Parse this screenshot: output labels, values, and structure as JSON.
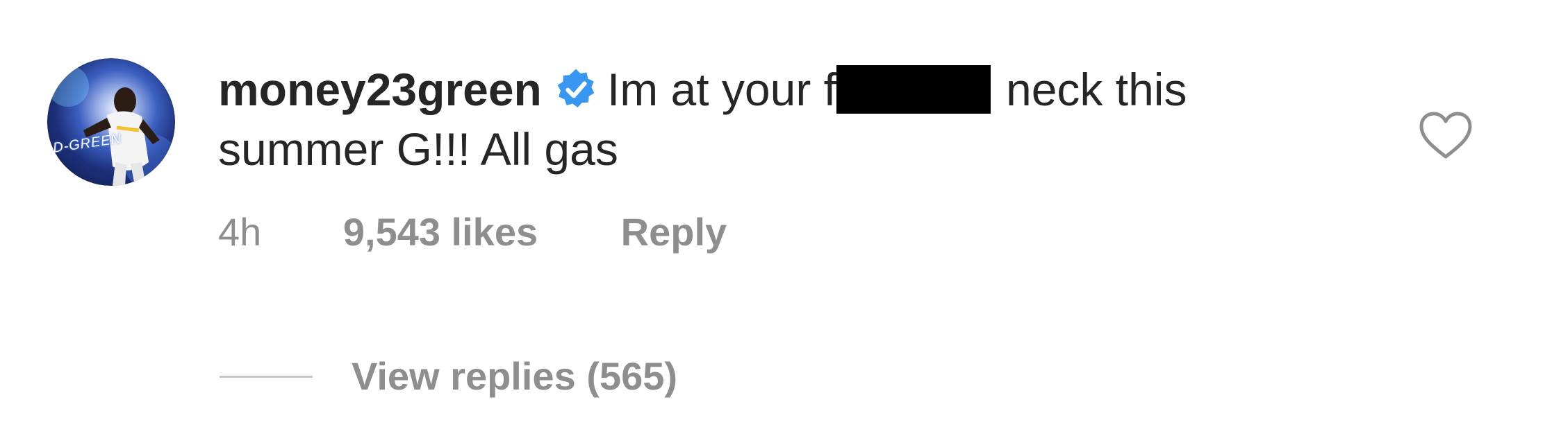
{
  "comment": {
    "avatar": {
      "alt_icon": "profile-photo",
      "overlay_text": "D-GREEN"
    },
    "username": "money23green",
    "verified_icon": "verified-badge-icon",
    "text_before_redaction": "Im at your f",
    "text_after_redaction": "neck this summer G!!! All gas",
    "time": "4h",
    "likes": "9,543 likes",
    "reply_label": "Reply",
    "like_icon": "heart-outline-icon",
    "view_replies_label": "View replies (565)"
  },
  "colors": {
    "text_primary": "#262626",
    "text_secondary": "#8e8e8e",
    "verified_blue": "#3897f0",
    "divider": "#c7c7c7",
    "redaction": "#000000"
  }
}
